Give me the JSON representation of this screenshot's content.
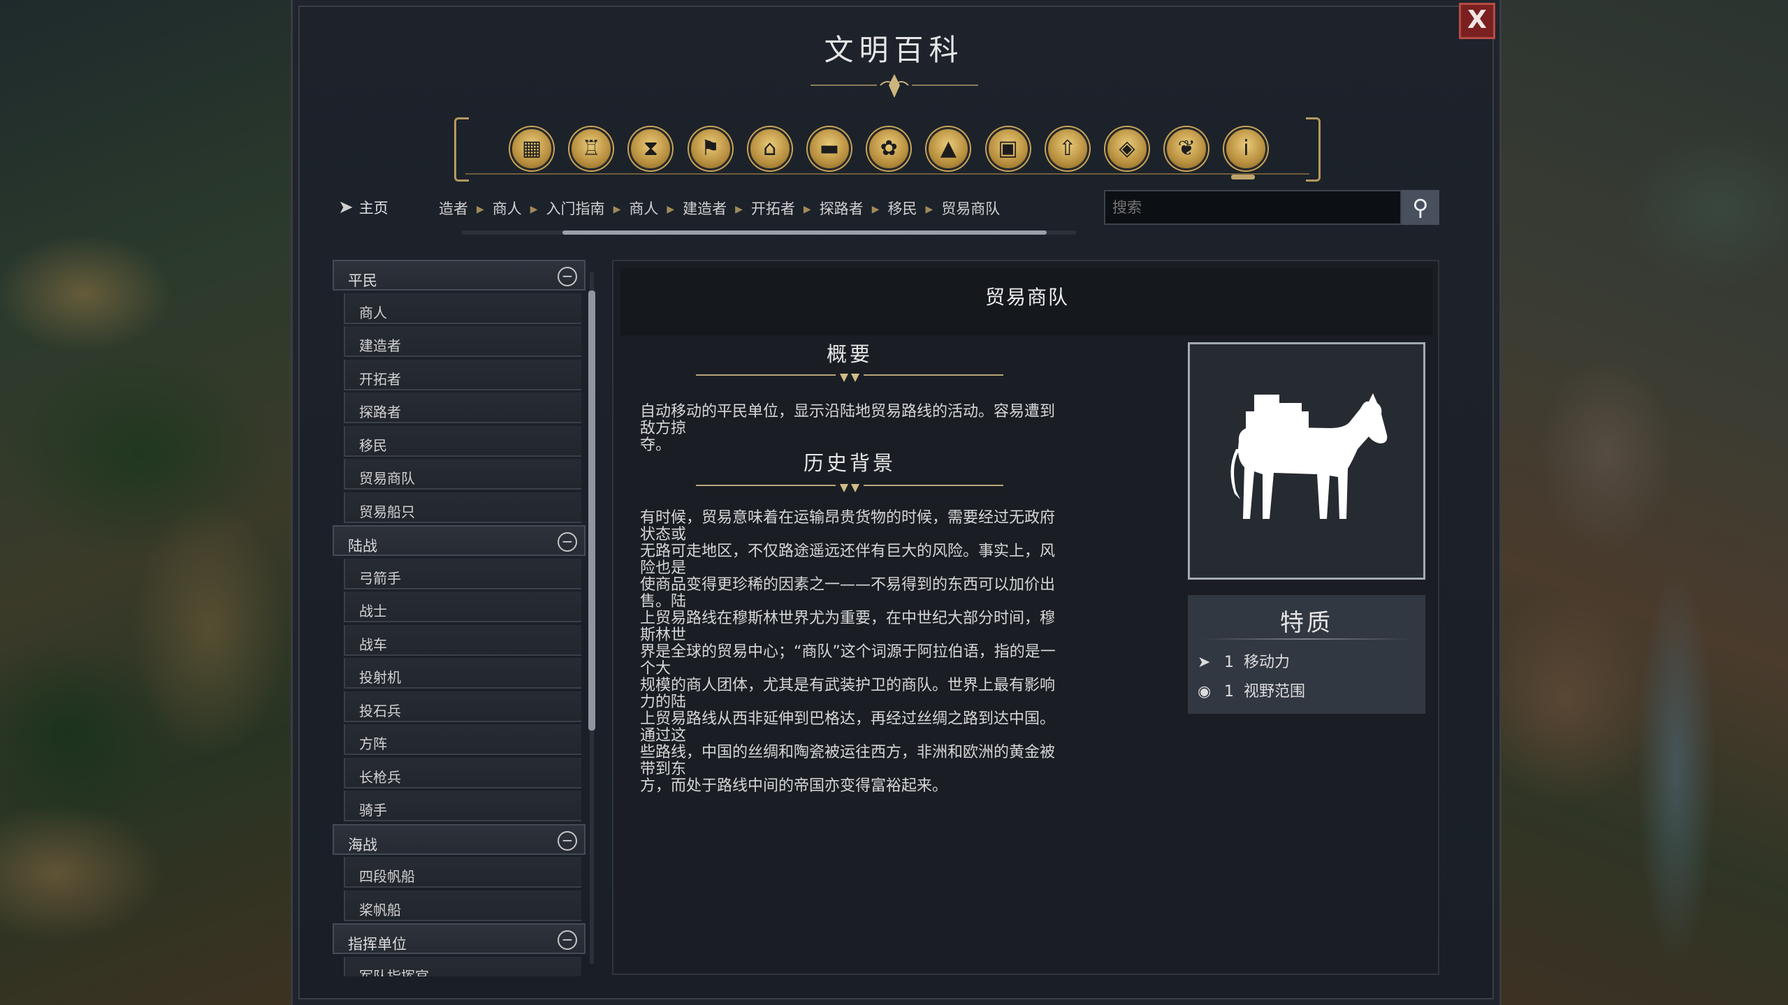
{
  "window": {
    "title": "文明百科",
    "close_label": "X"
  },
  "icon_bar": [
    {
      "name": "civilizations-icon",
      "glyph": "▦"
    },
    {
      "name": "leaders-icon",
      "glyph": "♖"
    },
    {
      "name": "eras-icon",
      "glyph": "⧗"
    },
    {
      "name": "flags-icon",
      "glyph": "⚑"
    },
    {
      "name": "buildings-icon",
      "glyph": "⌂"
    },
    {
      "name": "techs-icon",
      "glyph": "▬"
    },
    {
      "name": "resources-icon",
      "glyph": "✿"
    },
    {
      "name": "terrain-icon",
      "glyph": "▲"
    },
    {
      "name": "districts-icon",
      "glyph": "▣"
    },
    {
      "name": "upgrades-icon",
      "glyph": "⇧"
    },
    {
      "name": "books-icon",
      "glyph": "◈"
    },
    {
      "name": "diplomacy-icon",
      "glyph": "❦"
    },
    {
      "name": "info-icon",
      "glyph": "i"
    }
  ],
  "nav": {
    "home_label": "主页",
    "crumbs": [
      "造者",
      "商人",
      "入门指南",
      "商人",
      "建造者",
      "开拓者",
      "探路者",
      "移民",
      "贸易商队"
    ]
  },
  "search": {
    "placeholder": "搜索"
  },
  "sidebar": {
    "categories": [
      {
        "label": "平民",
        "items": [
          "商人",
          "建造者",
          "开拓者",
          "探路者",
          "移民",
          "贸易商队",
          "贸易船只"
        ]
      },
      {
        "label": "陆战",
        "items": [
          "弓箭手",
          "战士",
          "战车",
          "投射机",
          "投石兵",
          "方阵",
          "长枪兵",
          "骑手"
        ]
      },
      {
        "label": "海战",
        "items": [
          "四段帆船",
          "桨帆船"
        ]
      },
      {
        "label": "指挥单位",
        "items": [
          "军队指挥官"
        ]
      }
    ]
  },
  "article": {
    "title": "贸易商队",
    "overview_heading": "概要",
    "overview_lines": [
      "自动移动的平民单位，显示沿陆地贸易路线的活动。容易遭到敌方掠",
      "夺。"
    ],
    "history_heading": "历史背景",
    "history_lines": [
      "有时候，贸易意味着在运输昂贵货物的时候，需要经过无政府状态或",
      "无路可走地区，不仅路途遥远还伴有巨大的风险。事实上，风险也是",
      "使商品变得更珍稀的因素之一——不易得到的东西可以加价出售。陆",
      "上贸易路线在穆斯林世界尤为重要，在中世纪大部分时间，穆斯林世",
      "界是全球的贸易中心；“商队”这个词源于阿拉伯语，指的是一个大",
      "规模的商人团体，尤其是有武装护卫的商队。世界上最有影响力的陆",
      "上贸易路线从西非延伸到巴格达，再经过丝绸之路到达中国。通过这",
      "些路线，中国的丝绸和陶瓷被运往西方，非洲和欧洲的黄金被带到东",
      "方，而处于路线中间的帝国亦变得富裕起来。"
    ]
  },
  "traits": {
    "title": "特质",
    "items": [
      {
        "icon": "movement-arrow-icon",
        "value": "1",
        "label": "移动力"
      },
      {
        "icon": "eye-icon",
        "value": "1",
        "label": "视野范围"
      }
    ]
  }
}
